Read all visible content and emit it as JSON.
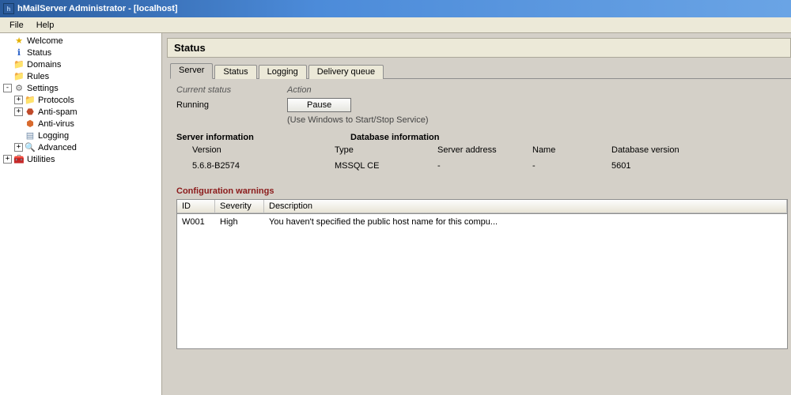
{
  "window": {
    "title": "hMailServer Administrator - [localhost]"
  },
  "menu": {
    "file": "File",
    "help": "Help"
  },
  "tree": {
    "welcome": "Welcome",
    "status": "Status",
    "domains": "Domains",
    "rules": "Rules",
    "settings": "Settings",
    "protocols": "Protocols",
    "antispam": "Anti-spam",
    "antivirus": "Anti-virus",
    "logging": "Logging",
    "advanced": "Advanced",
    "utilities": "Utilities"
  },
  "page": {
    "heading": "Status"
  },
  "tabs": {
    "server": "Server",
    "status": "Status",
    "logging": "Logging",
    "delivery_queue": "Delivery queue"
  },
  "server": {
    "current_status_label": "Current status",
    "action_label": "Action",
    "running": "Running",
    "pause_btn": "Pause",
    "service_tip": "(Use Windows to Start/Stop Service)",
    "server_info_hdr": "Server information",
    "db_info_hdr": "Database information",
    "version_label": "Version",
    "type_label": "Type",
    "server_addr_label": "Server address",
    "name_label": "Name",
    "db_version_label": "Database version",
    "version": "5.6.8-B2574",
    "db_type": "MSSQL CE",
    "server_addr": "-",
    "db_name": "-",
    "db_version": "5601"
  },
  "warnings": {
    "heading": "Configuration warnings",
    "col_id": "ID",
    "col_severity": "Severity",
    "col_desc": "Description",
    "rows": [
      {
        "id": "W001",
        "severity": "High",
        "desc": "You haven't specified the public host name for this compu..."
      }
    ]
  }
}
